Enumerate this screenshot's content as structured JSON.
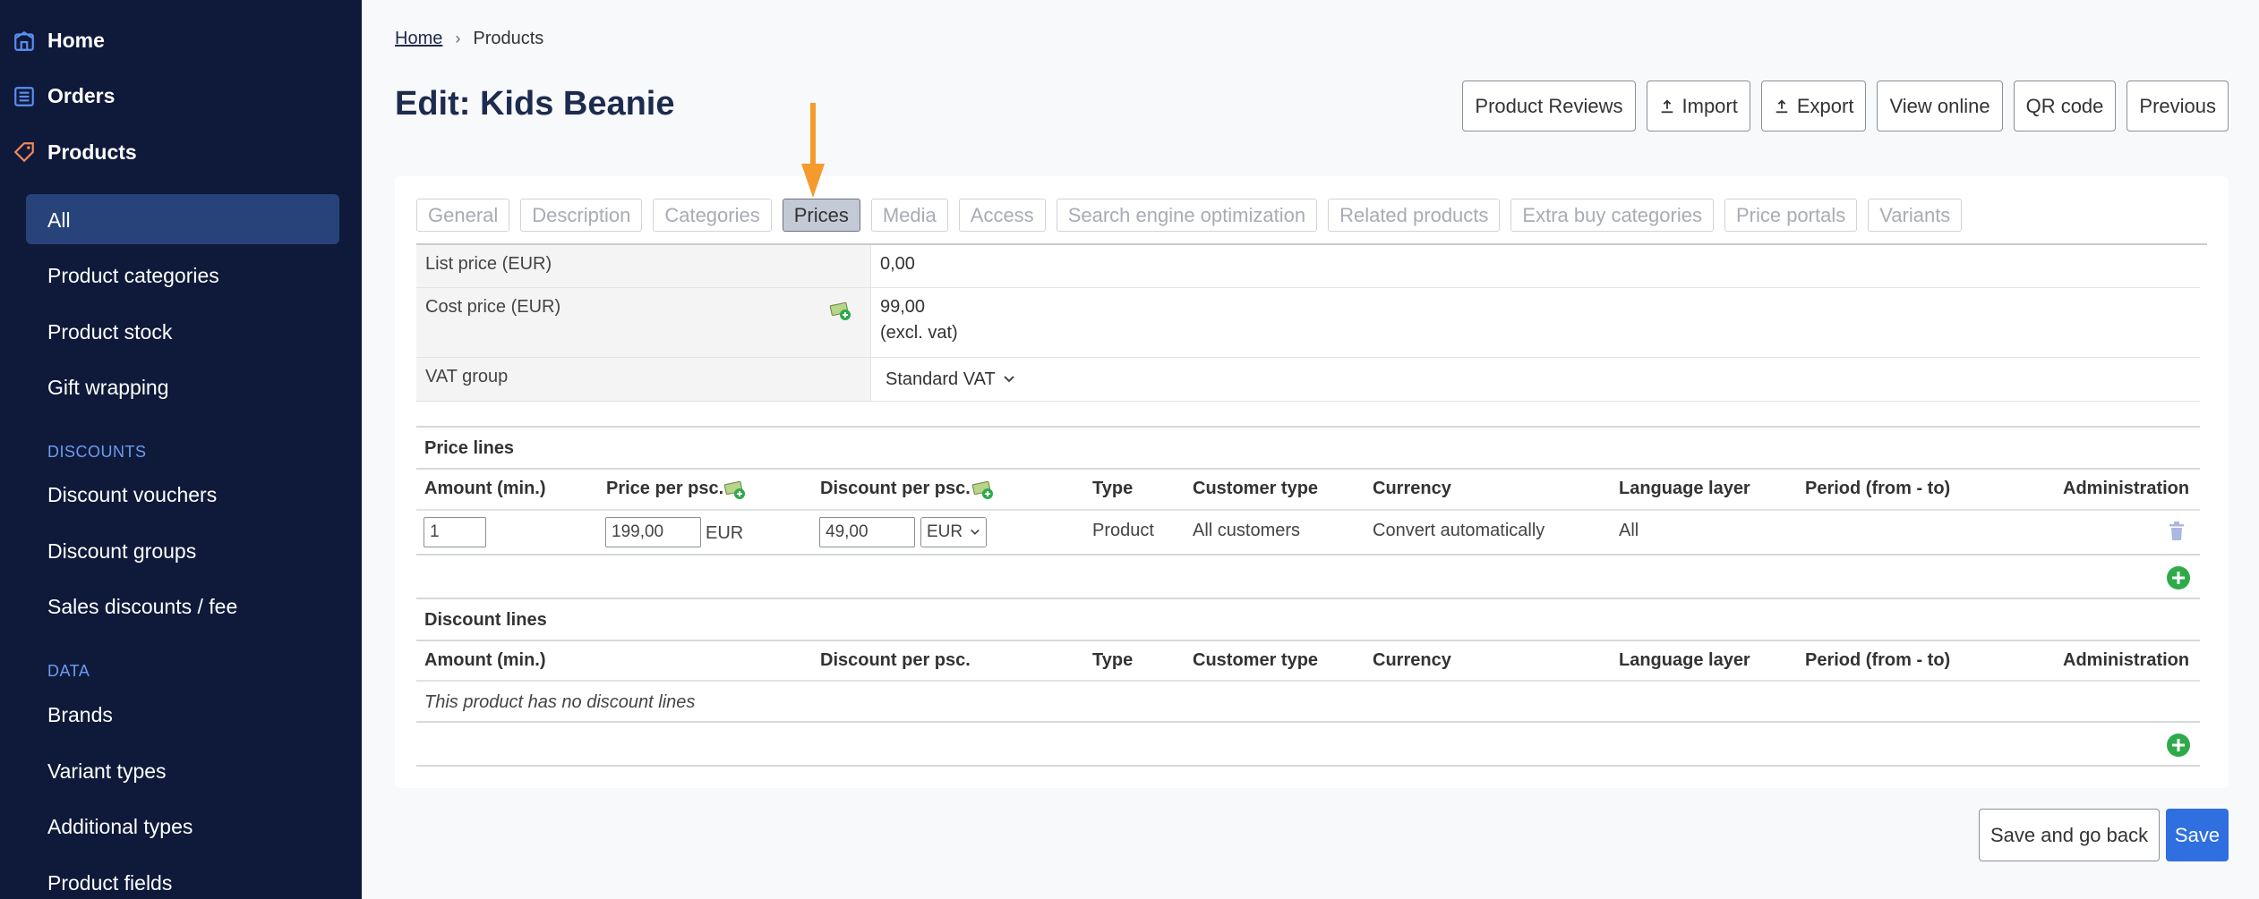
{
  "sidebar": {
    "nav": [
      {
        "label": "Home",
        "icon": "home-icon"
      },
      {
        "label": "Orders",
        "icon": "list-icon"
      },
      {
        "label": "Products",
        "icon": "tag-icon"
      }
    ],
    "product_items": [
      "All",
      "Product categories",
      "Product stock",
      "Gift wrapping"
    ],
    "discounts_heading": "DISCOUNTS",
    "discount_items": [
      "Discount vouchers",
      "Discount groups",
      "Sales discounts / fee"
    ],
    "data_heading": "DATA",
    "data_items": [
      "Brands",
      "Variant types",
      "Additional types",
      "Product fields"
    ],
    "colors": {
      "background": "#0f1a3a",
      "active": "#27437a",
      "section": "#6d9bf1"
    }
  },
  "breadcrumb": {
    "home": "Home",
    "current": "Products"
  },
  "page_title": "Edit: Kids Beanie",
  "actions": [
    "Product Reviews",
    "Import",
    "Export",
    "View online",
    "QR code",
    "Previous"
  ],
  "tabs": [
    "General",
    "Description",
    "Categories",
    "Prices",
    "Media",
    "Access",
    "Search engine optimization",
    "Related products",
    "Extra buy categories",
    "Price portals",
    "Variants"
  ],
  "active_tab": "Prices",
  "price_info": {
    "list_price_label": "List price (EUR)",
    "list_price_value": "0,00",
    "cost_price_label": "Cost price (EUR)",
    "cost_price_value": "99,00",
    "cost_price_note": "(excl. vat)",
    "vat_label": "VAT group",
    "vat_value": "Standard VAT"
  },
  "price_lines": {
    "title": "Price lines",
    "headers": {
      "amount": "Amount (min.)",
      "price": "Price per psc.",
      "discount": "Discount per psc.",
      "type": "Type",
      "customer_type": "Customer type",
      "currency": "Currency",
      "language": "Language layer",
      "period": "Period (from - to)",
      "admin": "Administration"
    },
    "row": {
      "amount": "1",
      "price": "199,00",
      "price_currency": "EUR",
      "discount": "49,00",
      "discount_currency": "EUR",
      "type": "Product",
      "customer_type": "All customers",
      "currency": "Convert automatically",
      "language": "All"
    }
  },
  "discount_lines": {
    "title": "Discount lines",
    "headers": {
      "amount": "Amount (min.)",
      "discount": "Discount per psc.",
      "type": "Type",
      "customer_type": "Customer type",
      "currency": "Currency",
      "language": "Language layer",
      "period": "Period (from - to)",
      "admin": "Administration"
    },
    "empty": "This product has no discount lines"
  },
  "footer": {
    "save_back": "Save and go back",
    "save": "Save"
  },
  "colors": {
    "accent": "#2f6fe0",
    "add": "#2eaa4a",
    "arrow": "#f59a2c"
  }
}
